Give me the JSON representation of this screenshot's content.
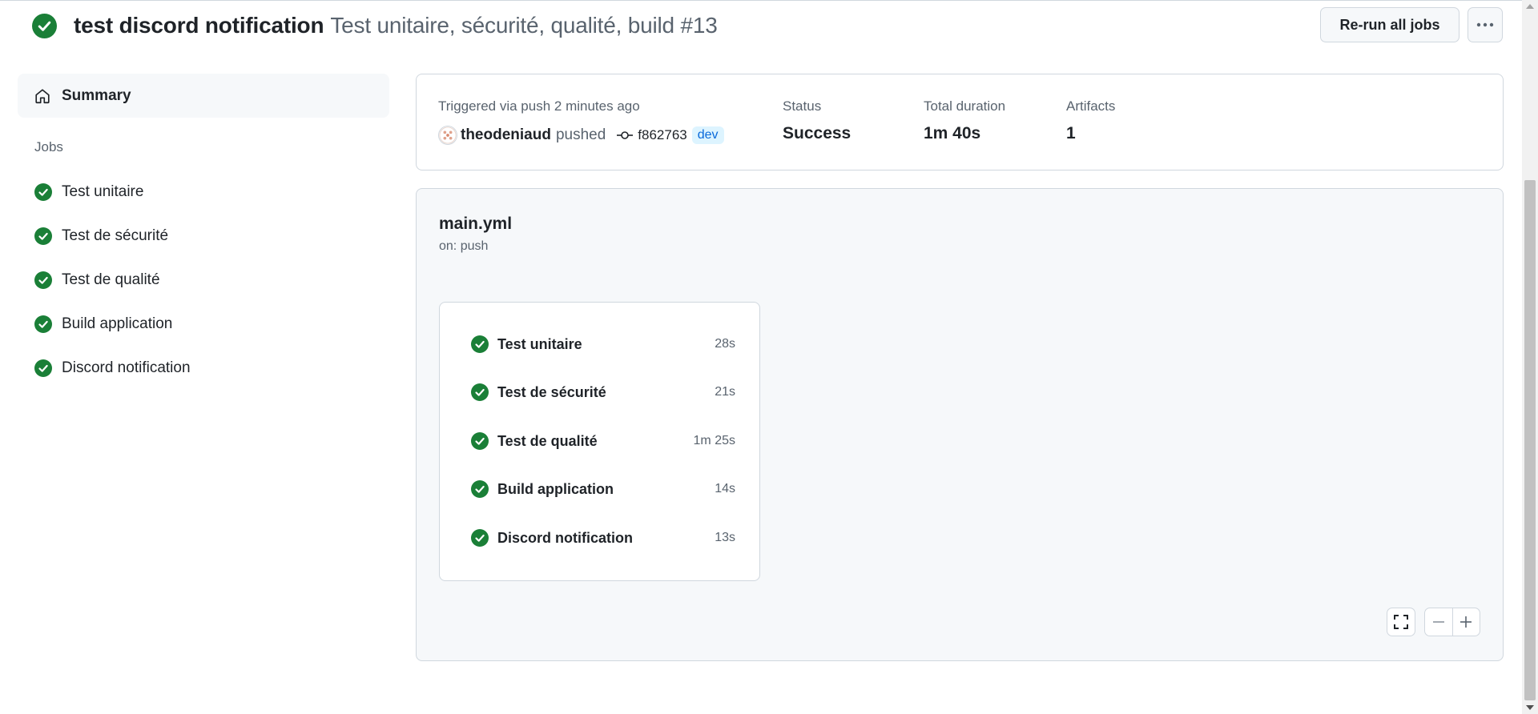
{
  "header": {
    "title": "test discord notification",
    "subtitle": "Test unitaire, sécurité, qualité, build #13",
    "rerun_label": "Re-run all jobs",
    "more_label": "···"
  },
  "sidebar": {
    "summary_label": "Summary",
    "jobs_heading": "Jobs",
    "jobs": [
      {
        "label": "Test unitaire"
      },
      {
        "label": "Test de sécurité"
      },
      {
        "label": "Test de qualité"
      },
      {
        "label": "Build application"
      },
      {
        "label": "Discord notification"
      }
    ]
  },
  "summary": {
    "trigger_text": "Triggered via push 2 minutes ago",
    "author": "theodeniaud",
    "action": "pushed",
    "commit": "f862763",
    "branch": "dev",
    "status_label": "Status",
    "status_value": "Success",
    "duration_label": "Total duration",
    "duration_value": "1m 40s",
    "artifacts_label": "Artifacts",
    "artifacts_value": "1"
  },
  "workflow": {
    "name": "main.yml",
    "trigger": "on: push",
    "jobs": [
      {
        "label": "Test unitaire",
        "duration": "28s"
      },
      {
        "label": "Test de sécurité",
        "duration": "21s"
      },
      {
        "label": "Test de qualité",
        "duration": "1m 25s"
      },
      {
        "label": "Build application",
        "duration": "14s"
      },
      {
        "label": "Discord notification",
        "duration": "13s"
      }
    ]
  },
  "colors": {
    "success": "#1a7f37",
    "accent": "#0969da",
    "border": "#d0d7de",
    "muted_text": "#59636e"
  }
}
